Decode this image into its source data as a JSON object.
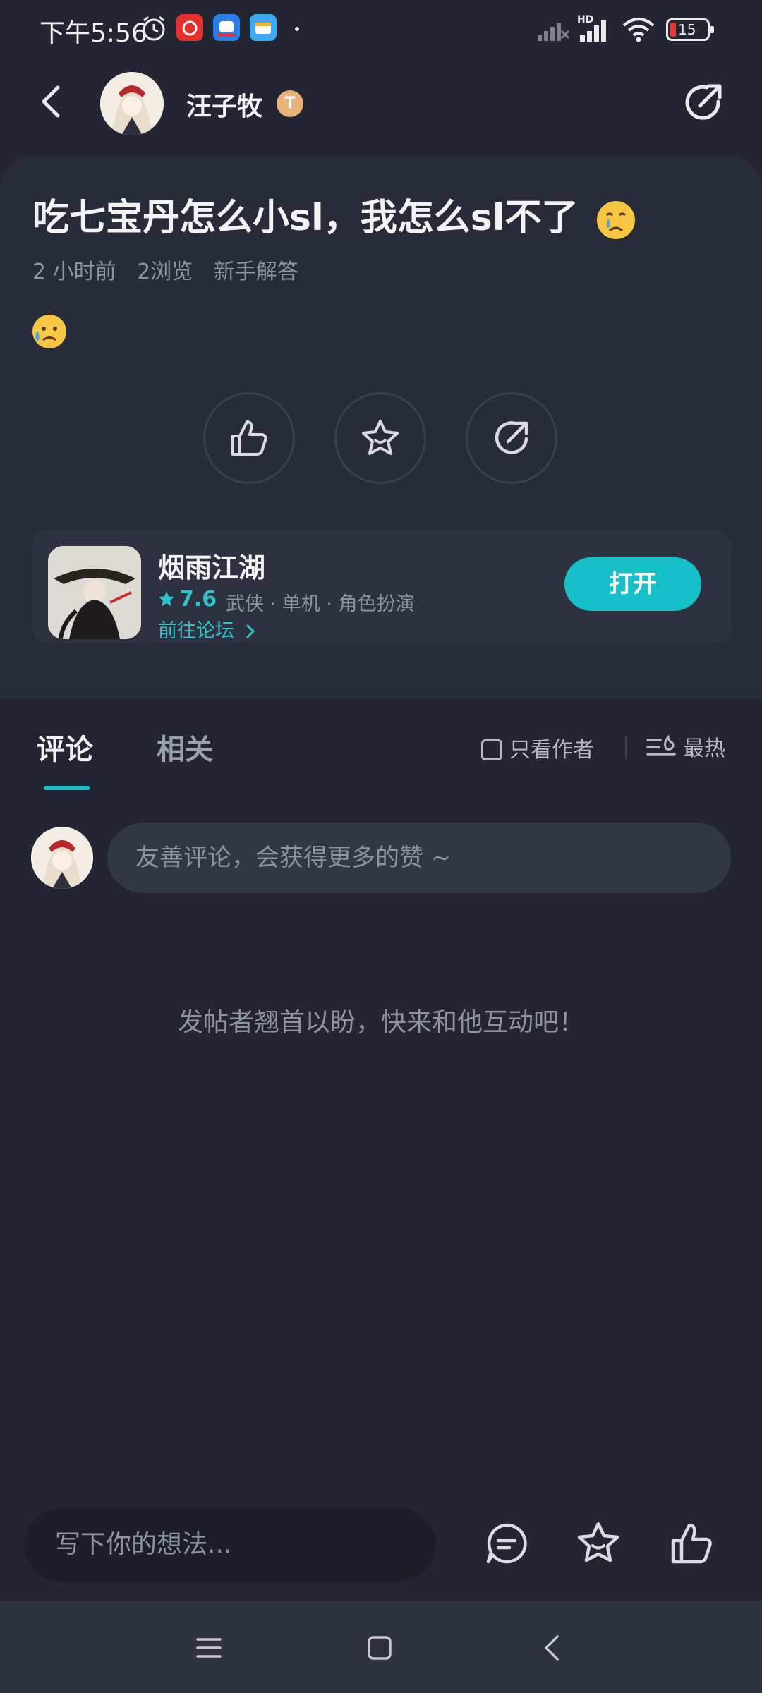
{
  "status_bar": {
    "time": "下午5:56",
    "battery": "15",
    "network": "HD"
  },
  "header": {
    "username": "汪子牧",
    "badge": "T"
  },
  "post": {
    "title": "吃七宝丹怎么小sl，我怎么sl不了",
    "meta": {
      "time_ago": "2 小时前",
      "views": "2浏览",
      "category": "新手解答"
    }
  },
  "game": {
    "name": "烟雨江湖",
    "rating": "7.6",
    "tags": "武侠 · 单机 · 角色扮演",
    "forum_link": "前往论坛",
    "open_button": "打开"
  },
  "comments": {
    "tabs": [
      {
        "label": "评论"
      },
      {
        "label": "相关"
      }
    ],
    "author_only": "只看作者",
    "sort": "最热",
    "input_placeholder": "友善评论，会获得更多的赞 ~",
    "empty_text": "发帖者翘首以盼，快来和他互动吧！"
  },
  "bottom_bar": {
    "input_placeholder": "写下你的想法..."
  },
  "colors": {
    "accent": "#16c0c8",
    "background": "#232632",
    "card": "#282c38"
  }
}
